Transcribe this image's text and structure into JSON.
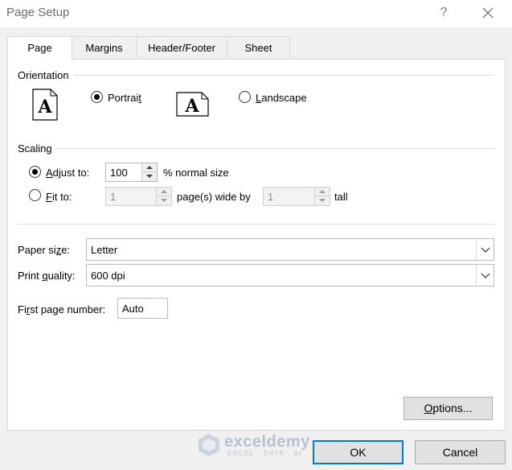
{
  "window": {
    "title": "Page Setup",
    "help": "?"
  },
  "tabs": [
    {
      "label": "Page"
    },
    {
      "label": "Margins"
    },
    {
      "label": "Header/Footer"
    },
    {
      "label": "Sheet"
    }
  ],
  "orientation": {
    "heading": "Orientation",
    "page_glyph": "A",
    "portrait": {
      "label": "Portrait",
      "accel": "t",
      "pre": "Portrai",
      "post": "",
      "checked": true
    },
    "landscape": {
      "label": "Landscape",
      "accel": "L",
      "pre": "",
      "post": "andscape",
      "checked": false
    }
  },
  "scaling": {
    "heading": "Scaling",
    "adjust": {
      "accel": "A",
      "rest": "djust to:",
      "value": "100",
      "suffix": "% normal size",
      "checked": true
    },
    "fit": {
      "accel": "F",
      "rest": "it to:",
      "wide_value": "1",
      "wide_label": "page(s) wide by",
      "tall_value": "1",
      "tall_label": "tall",
      "checked": false
    }
  },
  "paper_size": {
    "pre": "Paper si",
    "accel": "z",
    "post": "e:",
    "value": "Letter"
  },
  "print_quality": {
    "pre": "Print ",
    "accel": "q",
    "post": "uality:",
    "value": "600 dpi"
  },
  "first_page": {
    "pre": "Fi",
    "accel": "r",
    "post": "st page number:",
    "value": "Auto"
  },
  "buttons": {
    "options": {
      "accel": "O",
      "rest": "ptions..."
    },
    "ok": "OK",
    "cancel": "Cancel"
  },
  "watermark": {
    "name": "exceldemy",
    "tagline": "EXCEL · DATA · BI"
  },
  "colors": {
    "accent": "#0078d7",
    "dialog_bg": "#f0f0f0",
    "panel_bg": "#ffffff"
  }
}
